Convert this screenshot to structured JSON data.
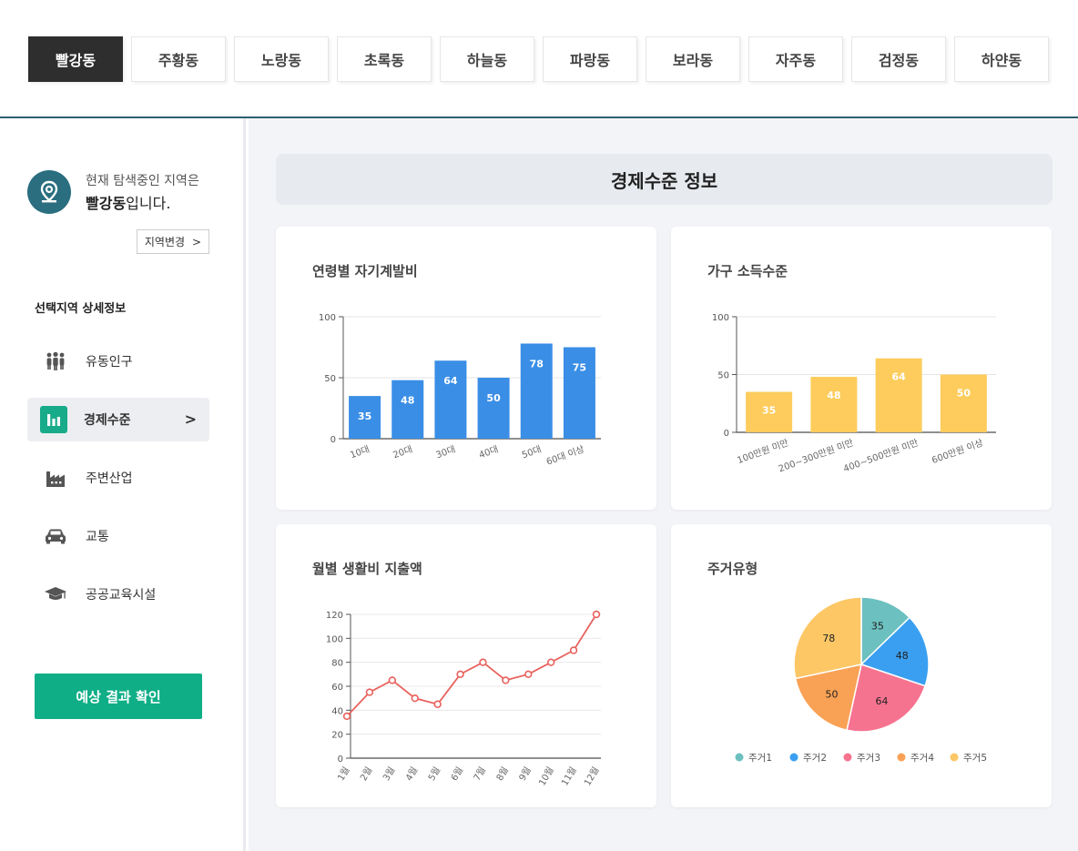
{
  "tabs": [
    "빨강동",
    "주황동",
    "노랑동",
    "초록동",
    "하늘동",
    "파랑동",
    "보라동",
    "자주동",
    "검정동",
    "하얀동"
  ],
  "active_tab": 0,
  "sidebar": {
    "location_line1": "현재 탐색중인 지역은",
    "location_name": "빨강동",
    "location_suffix": "입니다.",
    "change_button": "지역변경",
    "change_chevron": ">",
    "detail_title": "선택지역 상세정보",
    "menu": [
      {
        "label": "유동인구",
        "icon": "people-icon"
      },
      {
        "label": "경제수준",
        "icon": "bar-chart-icon",
        "active": true
      },
      {
        "label": "주변산업",
        "icon": "factory-icon"
      },
      {
        "label": "교통",
        "icon": "car-icon"
      },
      {
        "label": "공공교육시설",
        "icon": "graduation-cap-icon"
      }
    ],
    "active_chevron": ">",
    "predict_button": "예상 결과 확인"
  },
  "main": {
    "section_title": "경제수준 정보"
  },
  "colors": {
    "accent": "#0fae87",
    "tab_active": "#2e2e2e",
    "blue_bar": "#3a8ee6",
    "yellow_bar": "#fdcc5c",
    "line": "#e8625e"
  },
  "chart_data": [
    {
      "type": "bar",
      "title": "연령별 자기계발비",
      "categories": [
        "10대",
        "20대",
        "30대",
        "40대",
        "50대",
        "60대 이상"
      ],
      "values": [
        35,
        48,
        64,
        50,
        78,
        75
      ],
      "yticks": [
        0,
        50,
        100
      ],
      "ylim": [
        0,
        100
      ],
      "color": "#3a8ee6"
    },
    {
      "type": "bar",
      "title": "가구 소득수준",
      "categories": [
        "100만원 미만",
        "200~300만원 미만",
        "400~500만원 미만",
        "600만원 이상"
      ],
      "values": [
        35,
        48,
        64,
        50
      ],
      "yticks": [
        0,
        50,
        100
      ],
      "ylim": [
        0,
        100
      ],
      "color": "#fdcc5c"
    },
    {
      "type": "line",
      "title": "월별 생활비 지출액",
      "categories": [
        "1월",
        "2월",
        "3월",
        "4월",
        "5월",
        "6월",
        "7월",
        "8월",
        "9월",
        "10월",
        "11월",
        "12월"
      ],
      "values": [
        35,
        55,
        65,
        50,
        45,
        70,
        80,
        65,
        70,
        80,
        90,
        120
      ],
      "yticks": [
        0,
        20,
        40,
        60,
        80,
        100,
        120
      ],
      "ylim": [
        0,
        120
      ],
      "color": "#e8625e"
    },
    {
      "type": "pie",
      "title": "주거유형",
      "labels": [
        "주거1",
        "주거2",
        "주거3",
        "주거4",
        "주거5"
      ],
      "values": [
        35,
        48,
        64,
        50,
        78
      ],
      "colors": [
        "#6cc0c0",
        "#3a9ff0",
        "#f67390",
        "#f9a154",
        "#fdc766"
      ]
    }
  ]
}
